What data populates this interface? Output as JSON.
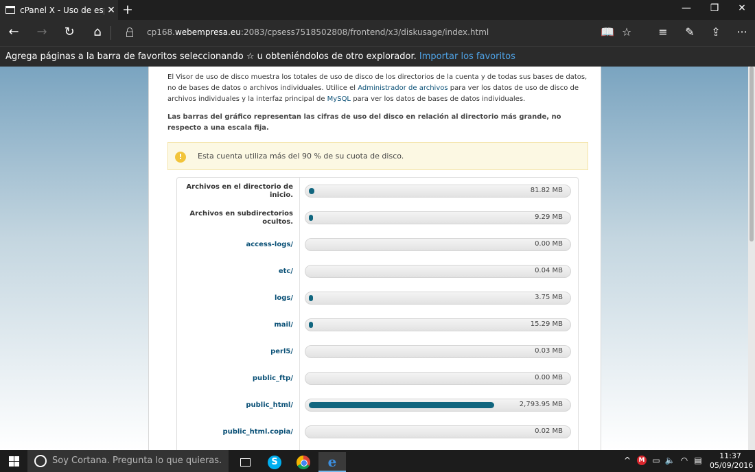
{
  "browser": {
    "tab_title": "cPanel X - Uso de espac",
    "tab_close": "✕",
    "new_tab": "+",
    "window_controls": {
      "minimize": "—",
      "restore": "❐",
      "close": "✕"
    },
    "nav": {
      "back": "←",
      "forward": "→",
      "refresh": "↻",
      "home": "⌂"
    },
    "url_prefix": "cp168.",
    "url_domain": "webempresa.eu",
    "url_rest": ":2083/cpsess7518502808/frontend/x3/diskusage/index.html",
    "tools": {
      "reading_view": "📖",
      "favorite": "☆",
      "hub": "≡",
      "notes": "✎",
      "share": "⇪",
      "more": "···"
    }
  },
  "favorites_bar": {
    "text": "Agrega páginas a la barra de favoritos seleccionando ☆ u obteniéndolos de otro explorador.",
    "link": "Importar los favoritos"
  },
  "page": {
    "intro_1": "El Visor de uso de disco muestra los totales de uso de disco de los directorios de la cuenta y de todas sus bases de datos, no de bases de datos o archivos individuales. Utilice el",
    "intro_link_1": "Administrador de archivos",
    "intro_2": "para ver los datos de uso de disco de archivos individuales y la interfaz principal de",
    "intro_link_2": "MySQL",
    "intro_3": "para ver los datos de bases de datos individuales.",
    "bars_note": "Las barras del gráfico representan las cifras de uso del disco en relación al directorio más grande, no respecto a una escala fija.",
    "alert_icon": "!",
    "alert_message": "Esta cuenta utiliza más del 90 % de su cuota de disco.",
    "rows": [
      {
        "label": "Archivos en el directorio de inicio.",
        "link": false,
        "size": "81.82 MB",
        "mb": 81.82
      },
      {
        "label": "Archivos en subdirectorios ocultos.",
        "link": false,
        "size": "9.29 MB",
        "mb": 9.29
      },
      {
        "label": "access-logs/",
        "link": true,
        "size": "0.00 MB",
        "mb": 0.0
      },
      {
        "label": "etc/",
        "link": true,
        "size": "0.04 MB",
        "mb": 0.04
      },
      {
        "label": "logs/",
        "link": true,
        "size": "3.75 MB",
        "mb": 3.75
      },
      {
        "label": "mail/",
        "link": true,
        "size": "15.29 MB",
        "mb": 15.29
      },
      {
        "label": "perl5/",
        "link": true,
        "size": "0.03 MB",
        "mb": 0.03
      },
      {
        "label": "public_ftp/",
        "link": true,
        "size": "0.00 MB",
        "mb": 0.0
      },
      {
        "label": "public_html/",
        "link": true,
        "size": "2,793.95 MB",
        "mb": 2793.95
      },
      {
        "label": "public_html.copia/",
        "link": true,
        "size": "0.02 MB",
        "mb": 0.02
      }
    ],
    "max_mb": 2793.95,
    "colors": {
      "bar_fill": "#11667f",
      "link": "#0b5177",
      "alert_bg": "#fcf8e3"
    }
  },
  "taskbar": {
    "search_hint": "Soy Cortana. Pregunta lo que quieras.",
    "tray": {
      "chevron": "^",
      "mega": "M",
      "battery": "▭",
      "volume": "🔈",
      "wifi": "◠",
      "notifications": "▤"
    },
    "time": "11:37",
    "date": "05/09/2016"
  }
}
